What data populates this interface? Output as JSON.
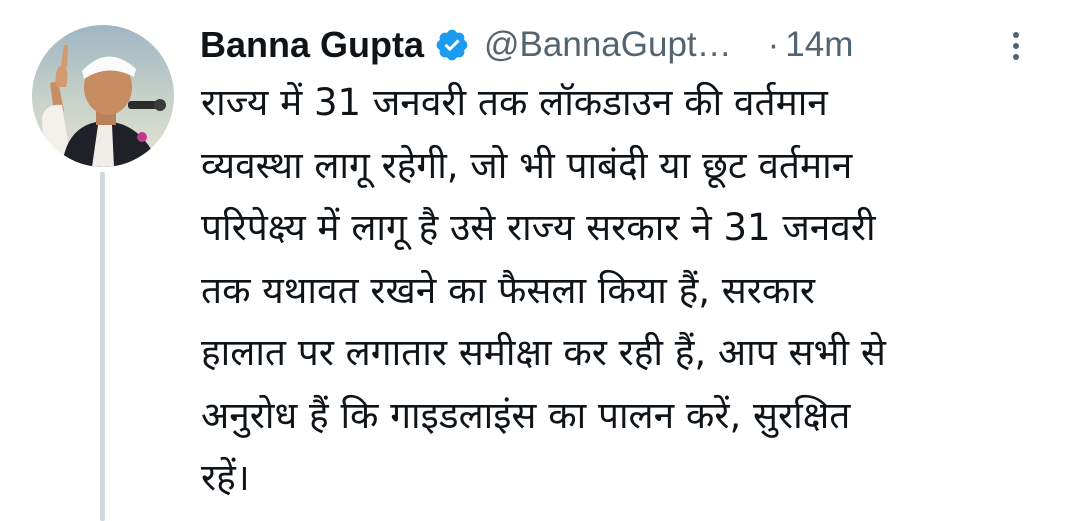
{
  "tweet": {
    "author": {
      "display_name": "Banna Gupta",
      "handle": "@BannaGupt…",
      "avatar_icon": "profile-photo",
      "verified_icon": "verified-badge-icon"
    },
    "separator": "·",
    "timestamp": "14m",
    "more_icon": "more-vertical-icon",
    "text_lines": [
      "राज्य में 31 जनवरी तक लॉकडाउन की वर्तमान",
      "व्यवस्था लागू रहेगी, जो भी पाबंदी या छूट वर्तमान",
      "परिपेक्ष्य में लागू है उसे राज्य सरकार ने 31 जनवरी",
      "तक यथावत रखने का फैसला किया हैं, सरकार",
      "हालात पर लगातार समीक्षा कर रही हैं, आप सभी से",
      "अनुरोध हैं कि गाइडलाइंस का पालन करें, सुरक्षित",
      "रहें।"
    ]
  },
  "colors": {
    "text_primary": "#0f1419",
    "text_secondary": "#536471",
    "verified_blue": "#1d9bf0",
    "thread_line": "#cfd9de"
  }
}
